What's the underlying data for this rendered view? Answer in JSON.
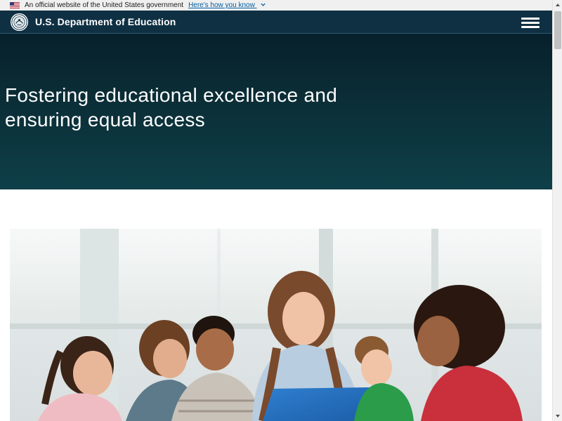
{
  "gov_banner": {
    "official_text": "An official website of the United States government",
    "how_link": "Here's how you know",
    "flag_icon": "us-flag-icon",
    "chevron_icon": "chevron-down-icon"
  },
  "header": {
    "title": "U.S. Department of Education",
    "seal_icon": "department-seal-icon",
    "menu_icon": "hamburger-menu-icon",
    "background": "#0f3043"
  },
  "hero": {
    "headline": "Fostering educational excellence and ensuring equal access",
    "gradient_top": "#07202b",
    "gradient_bottom": "#0e3f48"
  },
  "photo": {
    "subject": "teacher-with-students-photo"
  },
  "scrollbar": {
    "up_icon": "scroll-up-icon",
    "down_icon": "scroll-down-icon"
  }
}
